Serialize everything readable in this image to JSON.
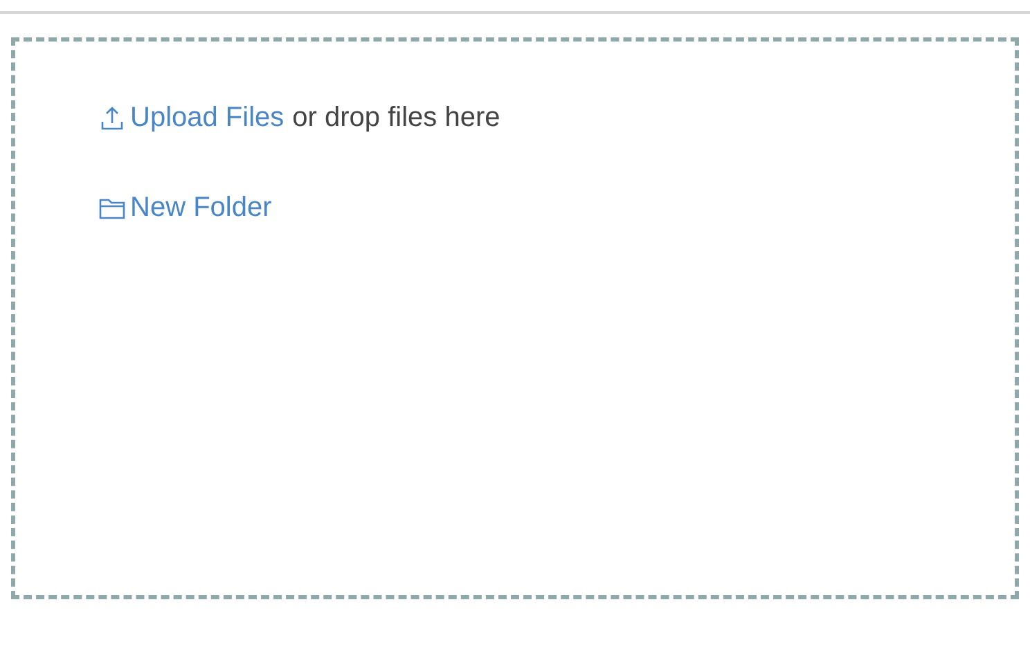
{
  "drop_zone": {
    "upload_link": "Upload Files",
    "drop_hint": "or drop files here",
    "new_folder_link": "New Folder"
  }
}
